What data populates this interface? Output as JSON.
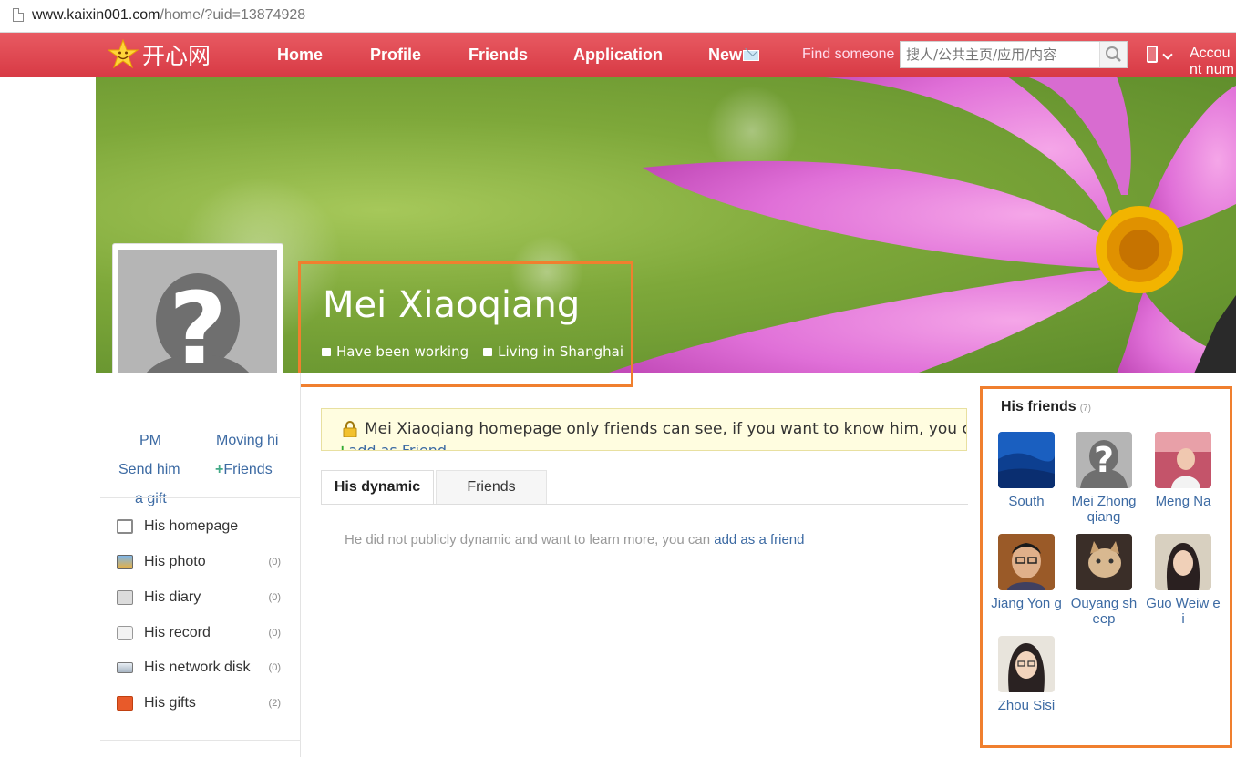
{
  "browser": {
    "url_main": "www.kaixin001.com",
    "url_rest": "/home/?uid=13874928"
  },
  "nav": {
    "logo_text": "开心网",
    "items": [
      "Home",
      "Profile",
      "Friends",
      "Application",
      "New"
    ],
    "find_label": "Find someone",
    "search_placeholder": "搜人/公共主页/应用/内容",
    "account_label": "Account number"
  },
  "profile": {
    "name": "Mei Xiaoqiang",
    "work": "Have been working",
    "living": "Living in Shanghai",
    "actions": {
      "pm": "PM",
      "moving_hi": "Moving hi",
      "send_gift_1": "Send him",
      "send_gift_2": "a gift",
      "friends": "Friends"
    }
  },
  "menu": [
    {
      "label": "His homepage",
      "count": ""
    },
    {
      "label": "His photo",
      "count": "(0)"
    },
    {
      "label": "His diary",
      "count": "(0)"
    },
    {
      "label": "His record",
      "count": "(0)"
    },
    {
      "label": "His network disk",
      "count": "(0)"
    },
    {
      "label": "His gifts",
      "count": "(2)"
    }
  ],
  "notice": {
    "text": "Mei Xiaoqiang homepage only friends can see, if you want to know him, you can",
    "link": "add as Friend"
  },
  "tabs": [
    "His dynamic",
    "Friends"
  ],
  "dynamic": {
    "text": "He did not publicly dynamic and want to learn more, you can ",
    "link": "add as a friend"
  },
  "friends": {
    "title": "His friends",
    "count": "(7)",
    "list": [
      {
        "name": "South",
        "avatar": "landscape"
      },
      {
        "name": "Mei Zhong qiang",
        "avatar": "placeholder"
      },
      {
        "name": "Meng Na",
        "avatar": "photo-red"
      },
      {
        "name": "Jiang Yon g",
        "avatar": "photo-man"
      },
      {
        "name": "Ouyang sh eep",
        "avatar": "photo-cat"
      },
      {
        "name": "Guo Weiw ei",
        "avatar": "photo-woman"
      },
      {
        "name": "Zhou Sisi",
        "avatar": "photo-woman-2"
      }
    ]
  },
  "colors": {
    "nav_red": "#d83a45",
    "link_blue": "#3c6aa3",
    "highlight_orange": "#f07f2e"
  }
}
